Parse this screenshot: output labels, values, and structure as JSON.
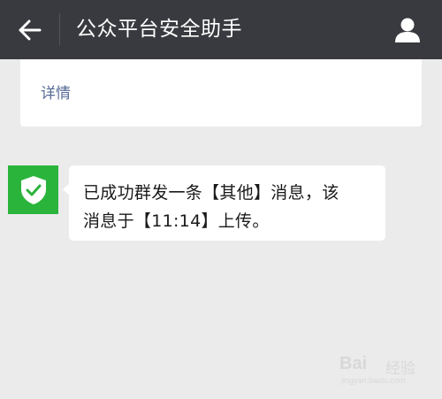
{
  "header": {
    "title": "公众平台安全助手",
    "back_icon": "arrow-left-icon",
    "profile_icon": "person-icon"
  },
  "previous_card": {
    "detail_label": "详情"
  },
  "message": {
    "avatar_icon": "shield-check-icon",
    "line1": "已成功群发一条【其他】消息，该",
    "line2": "消息于【11:14】上传。"
  },
  "watermark": {
    "brand": "Bai",
    "sub": "经验",
    "url": "jingyan.baidu.com"
  },
  "colors": {
    "header_bg": "#393a3f",
    "background": "#ebebeb",
    "link": "#576b95",
    "avatar_green": "#2bb43c"
  }
}
